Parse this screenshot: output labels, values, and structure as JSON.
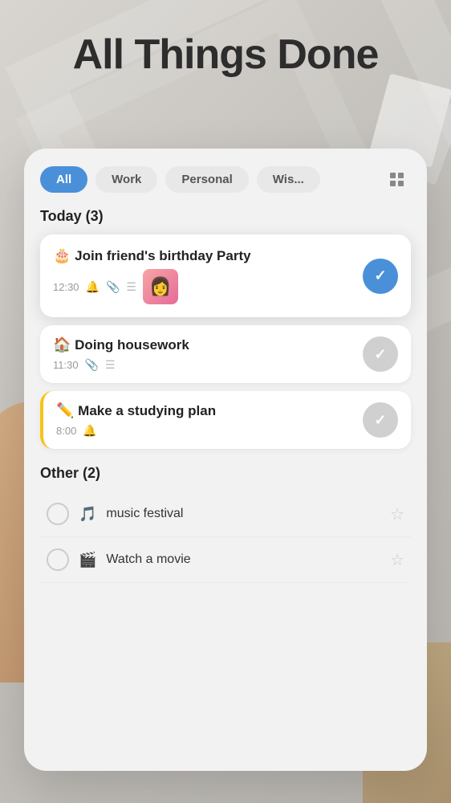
{
  "app": {
    "title": "All Things Done"
  },
  "filters": {
    "tabs": [
      {
        "id": "all",
        "label": "All",
        "active": true
      },
      {
        "id": "work",
        "label": "Work",
        "active": false
      },
      {
        "id": "personal",
        "label": "Personal",
        "active": false
      },
      {
        "id": "wis",
        "label": "Wis...",
        "active": false
      }
    ],
    "grid_label": "grid"
  },
  "today_section": {
    "header": "Today (3)",
    "tasks": [
      {
        "id": "task1",
        "emoji": "🎂",
        "title": "Join friend's birthday Party",
        "time": "12:30",
        "has_bell": true,
        "has_attachment": true,
        "has_list": true,
        "has_thumbnail": true,
        "completed": true
      },
      {
        "id": "task2",
        "emoji": "🏠",
        "title": "Doing housework",
        "time": "11:30",
        "has_bell": false,
        "has_attachment": true,
        "has_list": true,
        "has_thumbnail": false,
        "completed": false,
        "left_border": false
      },
      {
        "id": "task3",
        "emoji": "✏️",
        "title": "Make a studying plan",
        "time": "8:00",
        "has_bell": true,
        "has_attachment": false,
        "has_list": false,
        "has_thumbnail": false,
        "completed": false,
        "left_border": true
      }
    ]
  },
  "other_section": {
    "header": "Other (2)",
    "tasks": [
      {
        "id": "other1",
        "emoji": "🎵",
        "label": "music festival",
        "starred": false
      },
      {
        "id": "other2",
        "emoji": "🎬",
        "label": "Watch a movie",
        "starred": false
      }
    ]
  }
}
